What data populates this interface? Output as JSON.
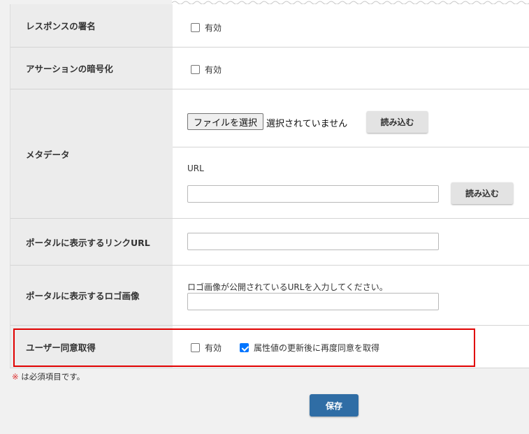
{
  "rows": {
    "response_signature": {
      "label": "レスポンスの署名",
      "checkbox_label": "有効"
    },
    "assertion_encryption": {
      "label": "アサーションの暗号化",
      "checkbox_label": "有効"
    },
    "metadata": {
      "label": "メタデータ",
      "file_button": "ファイルを選択",
      "file_status": "選択されていません",
      "load_button_1": "読み込む",
      "url_label": "URL",
      "url_value": "",
      "load_button_2": "読み込む"
    },
    "portal_link_url": {
      "label": "ポータルに表示するリンクURL",
      "value": ""
    },
    "portal_logo": {
      "label": "ポータルに表示するロゴ画像",
      "hint": "ロゴ画像が公開されているURLを入力してください。",
      "value": ""
    },
    "user_consent": {
      "label": "ユーザー同意取得",
      "enabled_label": "有効",
      "enabled_checked": false,
      "reconsent_label": "属性値の更新後に再度同意を取得",
      "reconsent_checked": true
    }
  },
  "required_note": {
    "mark": "※",
    "text": " は必須項目です。"
  },
  "save_button": "保存",
  "colors": {
    "highlight": "#e00000",
    "save_button": "#2f6da5",
    "checkbox_checked": "#0075ff"
  }
}
